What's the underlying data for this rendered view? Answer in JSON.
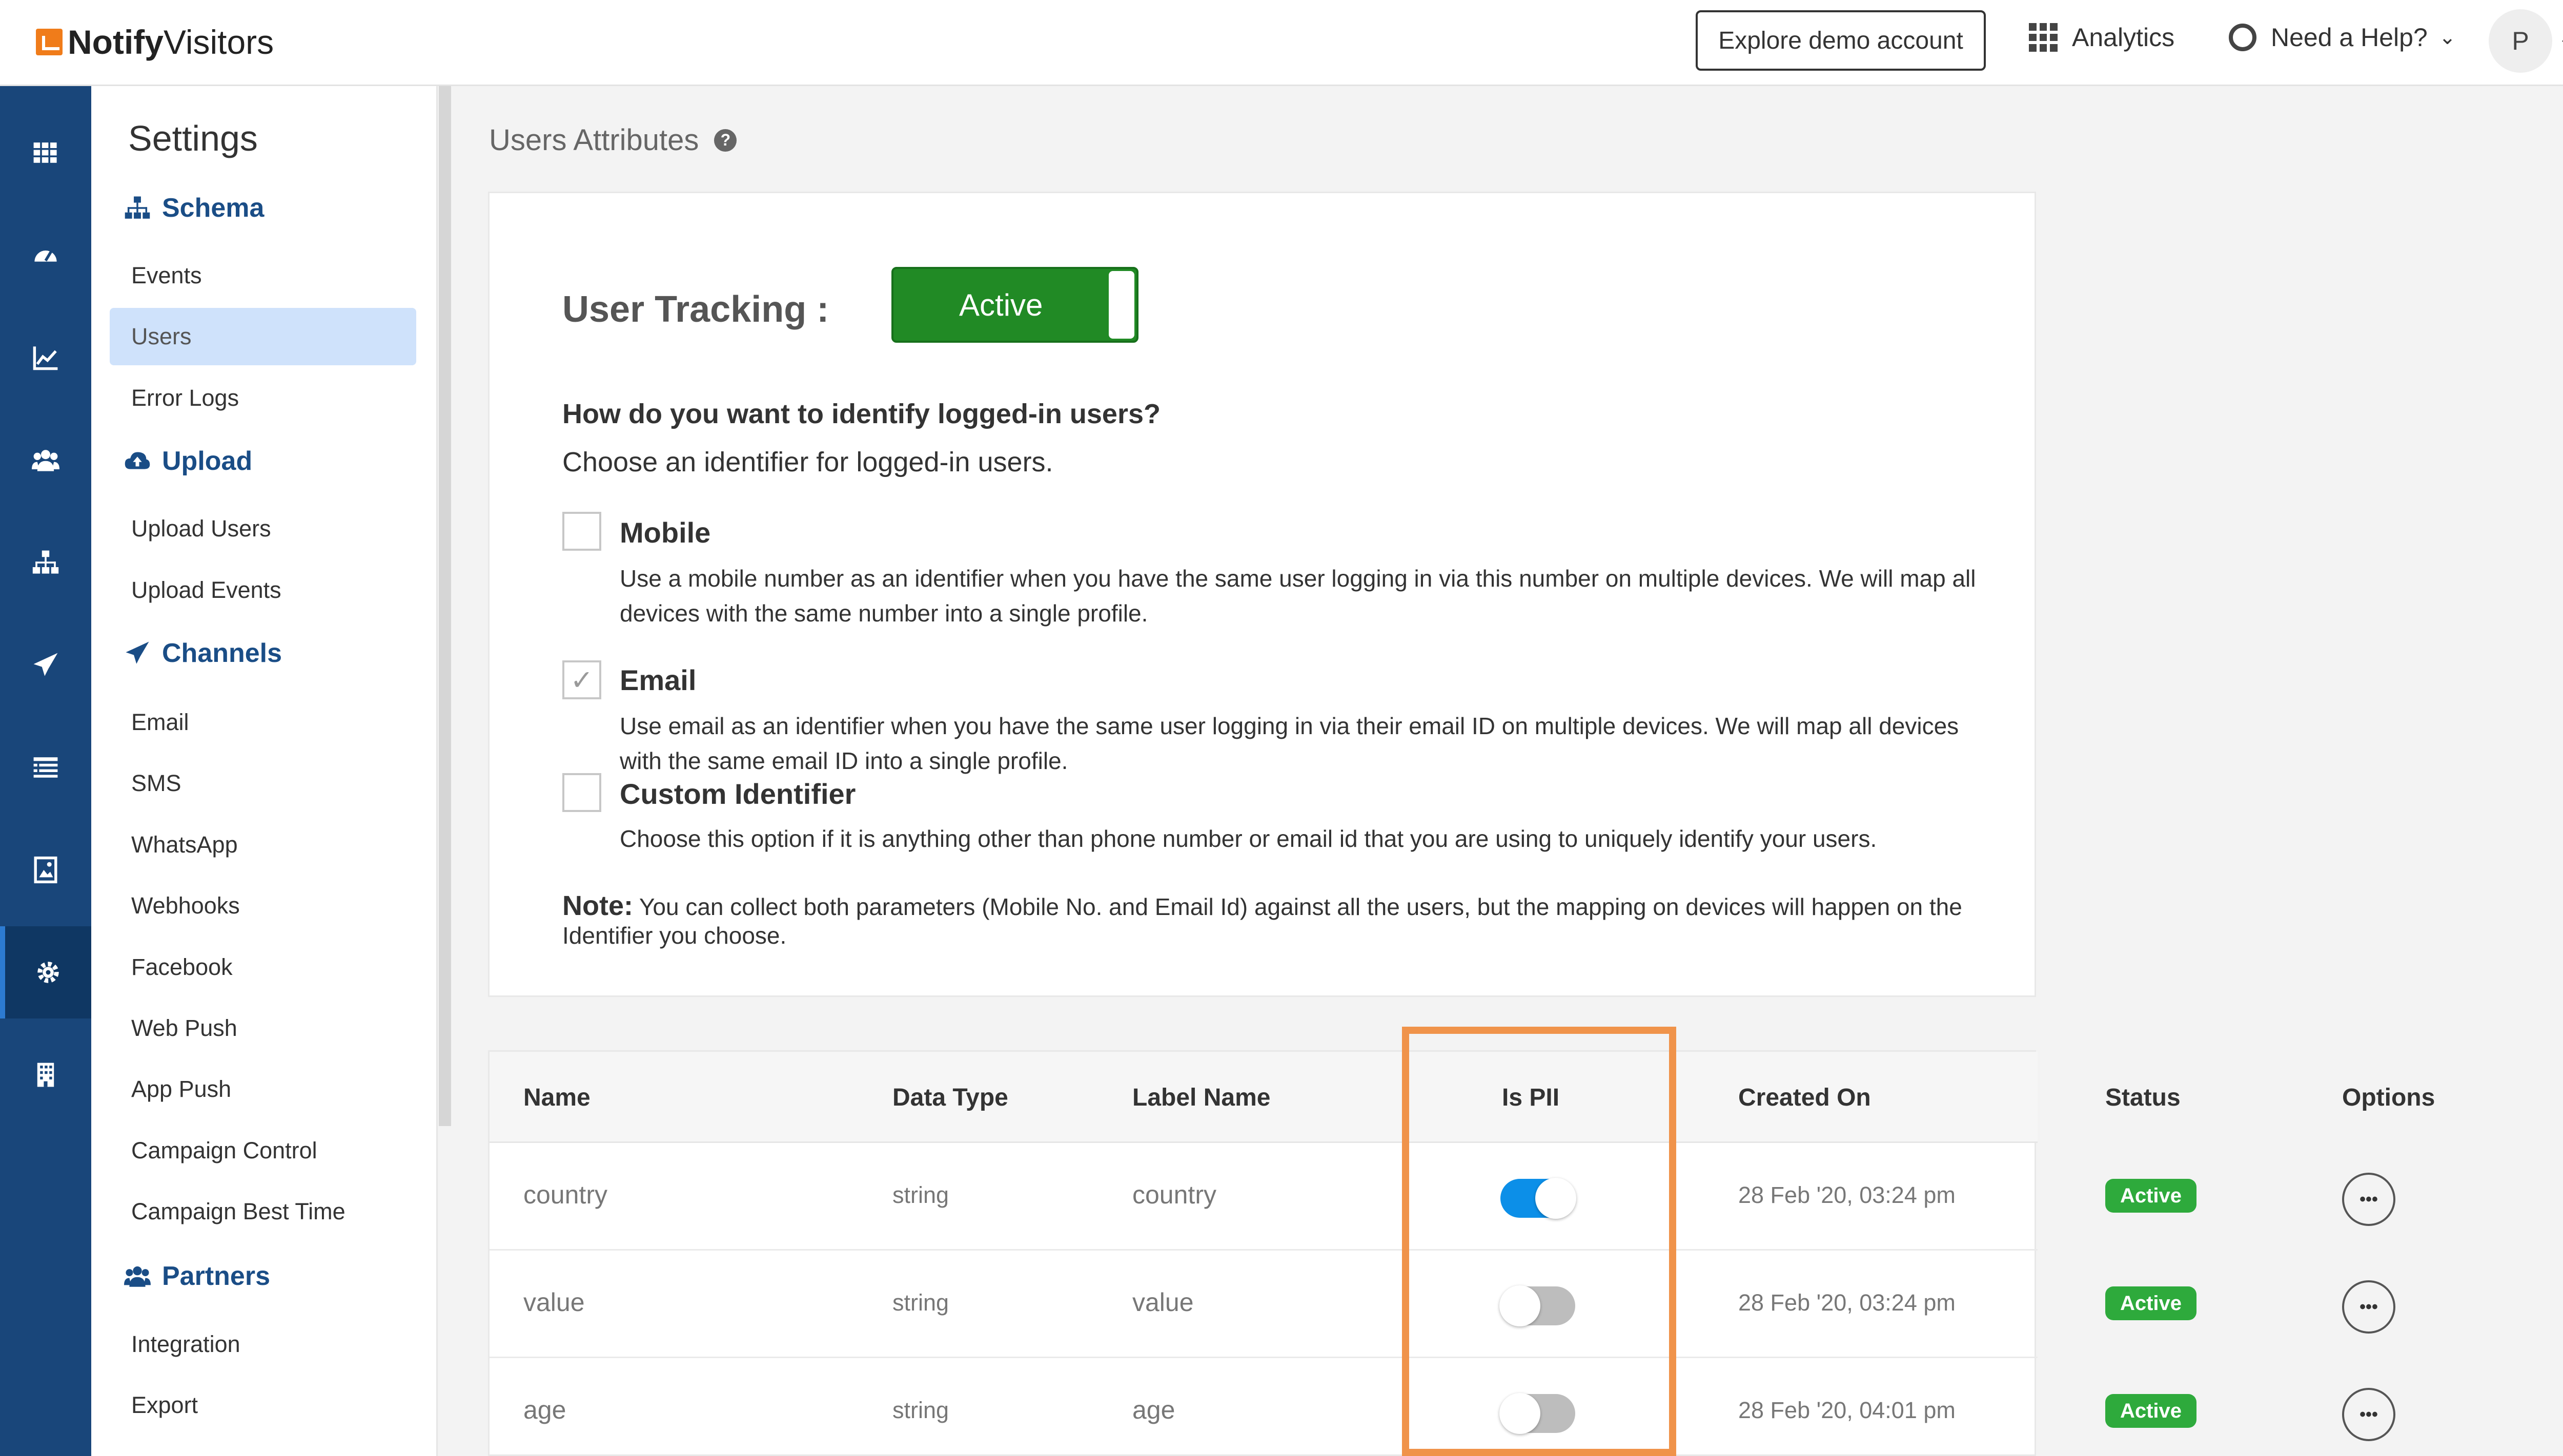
{
  "header": {
    "logo_text_bold": "Notify",
    "logo_text_regular": "Visitors",
    "demo_button": "Explore demo account",
    "analytics_label": "Analytics",
    "help_label": "Need a Help?",
    "avatar_initial": "P"
  },
  "rail": {
    "icons": [
      "apps-grid-icon",
      "dashboard-gauge-icon",
      "chart-line-icon",
      "users-group-icon",
      "schema-hierarchy-icon",
      "paper-plane-icon",
      "list-icon",
      "image-icon",
      "gear-icon",
      "building-icon"
    ],
    "active_index": 8
  },
  "sidebar": {
    "title": "Settings",
    "schema": {
      "label": "Schema",
      "items": [
        "Events",
        "Users",
        "Error Logs"
      ]
    },
    "upload": {
      "label": "Upload",
      "items": [
        "Upload Users",
        "Upload Events"
      ]
    },
    "channels": {
      "label": "Channels",
      "items": [
        "Email",
        "SMS",
        "WhatsApp",
        "Webhooks",
        "Facebook",
        "Web Push",
        "App Push",
        "Campaign Control",
        "Campaign Best Time"
      ]
    },
    "partners": {
      "label": "Partners",
      "items": [
        "Integration",
        "Export"
      ]
    },
    "active_item": "Users"
  },
  "main": {
    "title": "Users Attributes",
    "tracking_label": "User Tracking :",
    "tracking_state": "Active",
    "question": "How do you want to identify logged-in users?",
    "question_sub": "Choose an identifier for logged-in users.",
    "options": [
      {
        "label": "Mobile",
        "checked": false,
        "desc": "Use a mobile number as an identifier when you have the same user logging in via this number on multiple devices. We will map all devices with the same number into a single profile."
      },
      {
        "label": "Email",
        "checked": true,
        "desc": "Use email as an identifier when you have the same user logging in via their email ID on multiple devices. We will map all devices with the same email ID into a single profile."
      },
      {
        "label": "Custom Identifier",
        "checked": false,
        "desc": "Choose this option if it is anything other than phone number or email id that you are using to uniquely identify your users."
      }
    ],
    "note_label": "Note:",
    "note_text": " You can collect both parameters (Mobile No. and Email Id) against all the users, but the mapping on devices will happen on the Identifier you choose."
  },
  "table": {
    "headers": [
      "Name",
      "Data Type",
      "Label Name",
      "Is PII",
      "Created On",
      "Status",
      "Options"
    ],
    "rows": [
      {
        "name": "country",
        "type": "string",
        "label": "country",
        "pii": true,
        "created": "28 Feb '20, 03:24 pm",
        "status": "Active",
        "options": "•••"
      },
      {
        "name": "value",
        "type": "string",
        "label": "value",
        "pii": false,
        "created": "28 Feb '20, 03:24 pm",
        "status": "Active",
        "options": "•••"
      },
      {
        "name": "age",
        "type": "string",
        "label": "age",
        "pii": false,
        "created": "28 Feb '20, 04:01 pm",
        "status": "Active",
        "options": "•••"
      }
    ]
  },
  "colors": {
    "rail_bg": "#19467a",
    "brand_orange": "#f07c1a",
    "active_green": "#218a25",
    "toggle_on": "#0c8fe8",
    "highlight": "#f0934a"
  }
}
